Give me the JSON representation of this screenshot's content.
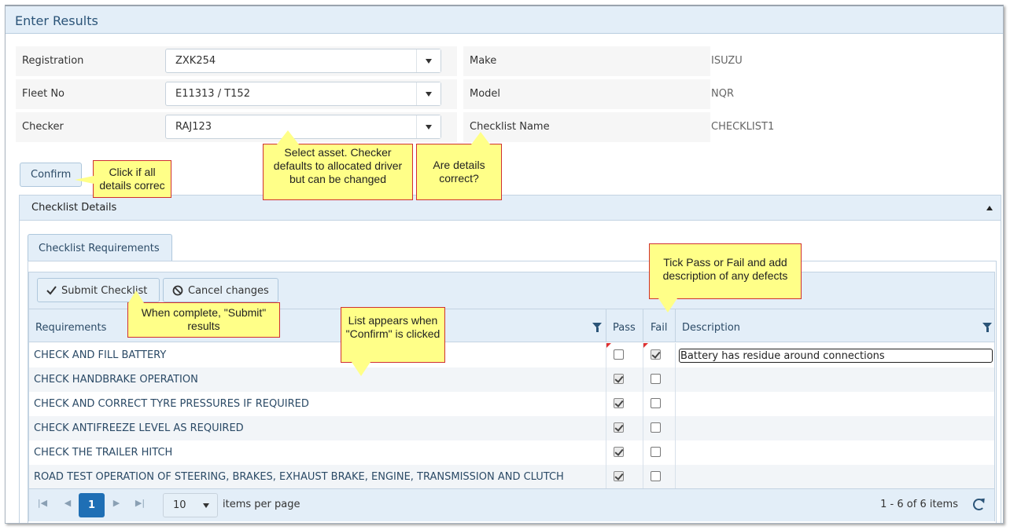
{
  "window": {
    "title": "Enter Results"
  },
  "form": {
    "registration": {
      "label": "Registration",
      "value": "ZXK254"
    },
    "fleet_no": {
      "label": "Fleet No",
      "value": "E11313 / T152"
    },
    "checker": {
      "label": "Checker",
      "value": "RAJ123"
    },
    "make": {
      "label": "Make",
      "value": "ISUZU"
    },
    "model": {
      "label": "Model",
      "value": "NQR"
    },
    "checklist_name": {
      "label": "Checklist Name",
      "value": "CHECKLIST1"
    }
  },
  "confirm_button": {
    "label": "Confirm"
  },
  "callouts": {
    "confirm": "Click if all details correc",
    "select_asset": "Select asset. Checker defaults to allocated driver but can be changed",
    "details": "Are details correct?",
    "tick": "Tick Pass or Fail and add description of any defects",
    "submit": "When complete, \"Submit\" results",
    "list": "List appears when \"Confirm\" is clicked"
  },
  "panel": {
    "title": "Checklist Details",
    "tab": "Checklist Requirements"
  },
  "toolbar": {
    "submit_label": "Submit Checklist",
    "cancel_label": "Cancel changes"
  },
  "grid": {
    "columns": {
      "requirements": "Requirements",
      "pass": "Pass",
      "fail": "Fail",
      "description": "Description"
    },
    "rows": [
      {
        "requirement": "CHECK AND FILL BATTERY",
        "pass": false,
        "fail": true,
        "description": "Battery has residue around connections"
      },
      {
        "requirement": "CHECK HANDBRAKE OPERATION",
        "pass": true,
        "fail": false,
        "description": ""
      },
      {
        "requirement": "CHECK AND CORRECT TYRE PRESSURES IF REQUIRED",
        "pass": true,
        "fail": false,
        "description": ""
      },
      {
        "requirement": "CHECK ANTIFREEZE LEVEL AS REQUIRED",
        "pass": true,
        "fail": false,
        "description": ""
      },
      {
        "requirement": "CHECK THE TRAILER HITCH",
        "pass": true,
        "fail": false,
        "description": ""
      },
      {
        "requirement": "ROAD TEST OPERATION OF STEERING, BRAKES, EXHAUST BRAKE, ENGINE, TRANSMISSION AND CLUTCH",
        "pass": true,
        "fail": false,
        "description": ""
      }
    ]
  },
  "pager": {
    "page": "1",
    "page_size": "10",
    "items_per_page_label": "items per page",
    "summary": "1 - 6 of 6 items"
  },
  "colors": {
    "header_bg": "#e3eef8",
    "accent": "#1f6fb5",
    "callout_bg": "#ffff88",
    "callout_border": "#d03030"
  }
}
